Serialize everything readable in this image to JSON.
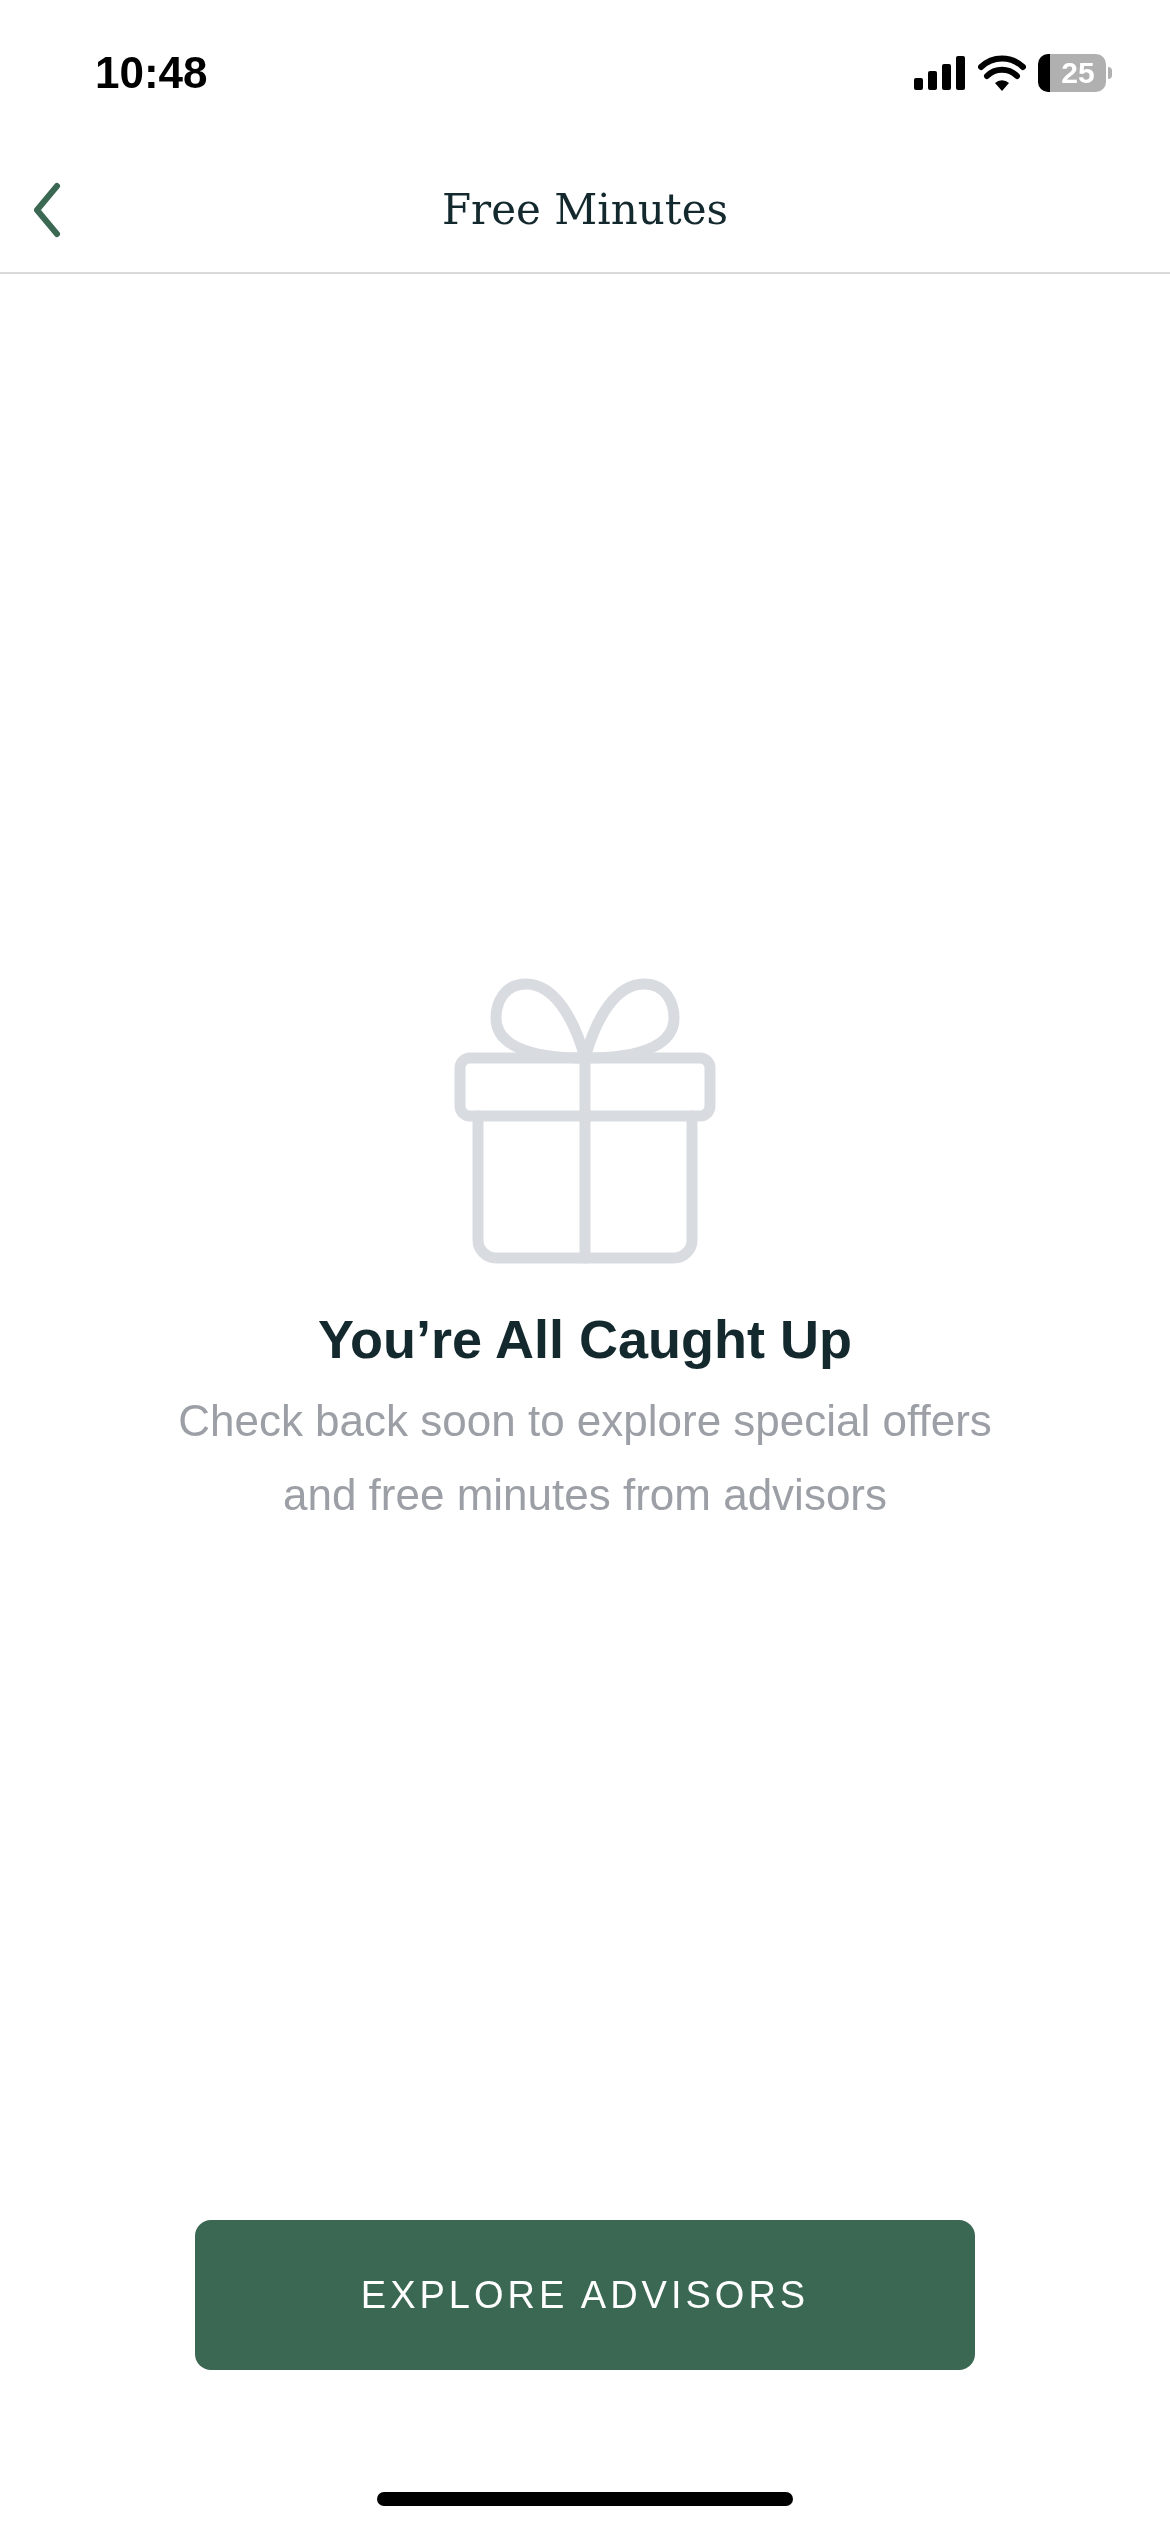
{
  "status_bar": {
    "time": "10:48",
    "battery": "25"
  },
  "header": {
    "title": "Free Minutes"
  },
  "empty_state": {
    "title": "You’re All Caught Up",
    "message_lines": [
      "Check back soon to explore special offers",
      "and free minutes from advisors"
    ]
  },
  "button": {
    "label": "EXPLORE ADVISORS"
  }
}
